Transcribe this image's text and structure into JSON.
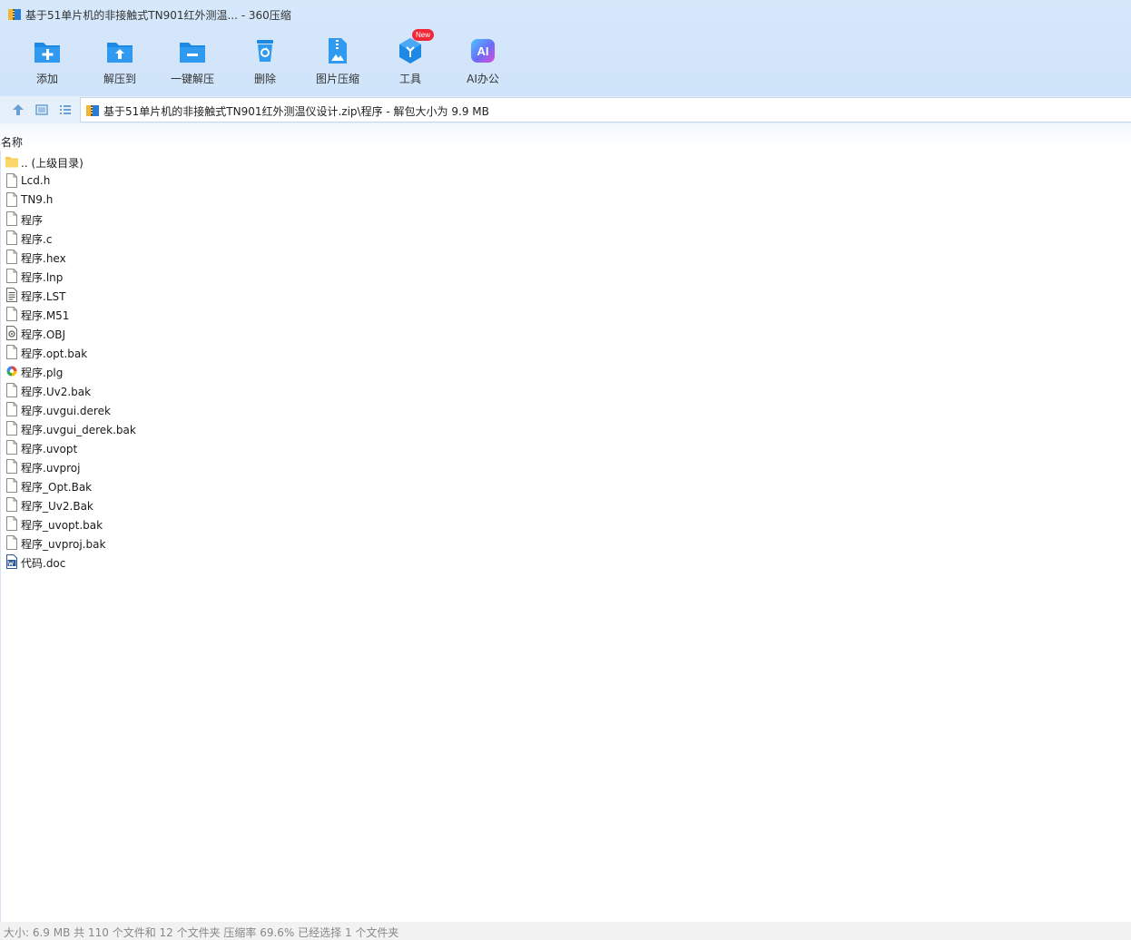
{
  "window": {
    "title": "基于51单片机的非接触式TN901红外测温... - 360压缩"
  },
  "toolbar": {
    "items": [
      {
        "label": "添加",
        "icon": "add-folder-icon"
      },
      {
        "label": "解压到",
        "icon": "extract-to-icon"
      },
      {
        "label": "一键解压",
        "icon": "one-click-extract-icon"
      },
      {
        "label": "删除",
        "icon": "delete-icon"
      },
      {
        "label": "图片压缩",
        "icon": "image-compress-icon"
      },
      {
        "label": "工具",
        "icon": "tools-icon",
        "badge": "New"
      },
      {
        "label": "AI办公",
        "icon": "ai-office-icon",
        "icon_text": "AI"
      }
    ]
  },
  "nav": {
    "path": "基于51单片机的非接触式TN901红外测温仪设计.zip\\程序 - 解包大小为 9.9 MB"
  },
  "list": {
    "column_name": "名称",
    "files": [
      {
        "name": ".. (上级目录)",
        "icon": "parent-folder-icon"
      },
      {
        "name": "Lcd.h",
        "icon": "file-icon"
      },
      {
        "name": "TN9.h",
        "icon": "file-icon"
      },
      {
        "name": "程序",
        "icon": "file-icon"
      },
      {
        "name": "程序.c",
        "icon": "file-icon"
      },
      {
        "name": "程序.hex",
        "icon": "file-icon"
      },
      {
        "name": "程序.lnp",
        "icon": "file-icon"
      },
      {
        "name": "程序.LST",
        "icon": "text-file-icon"
      },
      {
        "name": "程序.M51",
        "icon": "file-icon"
      },
      {
        "name": "程序.OBJ",
        "icon": "object-file-icon"
      },
      {
        "name": "程序.opt.bak",
        "icon": "file-icon"
      },
      {
        "name": "程序.plg",
        "icon": "plg-file-icon"
      },
      {
        "name": "程序.Uv2.bak",
        "icon": "file-icon"
      },
      {
        "name": "程序.uvgui.derek",
        "icon": "file-icon"
      },
      {
        "name": "程序.uvgui_derek.bak",
        "icon": "file-icon"
      },
      {
        "name": "程序.uvopt",
        "icon": "file-icon"
      },
      {
        "name": "程序.uvproj",
        "icon": "file-icon"
      },
      {
        "name": "程序_Opt.Bak",
        "icon": "file-icon"
      },
      {
        "name": "程序_Uv2.Bak",
        "icon": "file-icon"
      },
      {
        "name": "程序_uvopt.bak",
        "icon": "file-icon"
      },
      {
        "name": "程序_uvproj.bak",
        "icon": "file-icon"
      },
      {
        "name": "代码.doc",
        "icon": "word-doc-icon"
      }
    ]
  },
  "status": {
    "text": "大小: 6.9 MB 共 110 个文件和 12 个文件夹 压缩率 69.6% 已经选择 1 个文件夹"
  },
  "colors": {
    "accent": "#2b8fe8",
    "toolbar_bg": "#d2e5fa",
    "badge": "#f0283a"
  }
}
